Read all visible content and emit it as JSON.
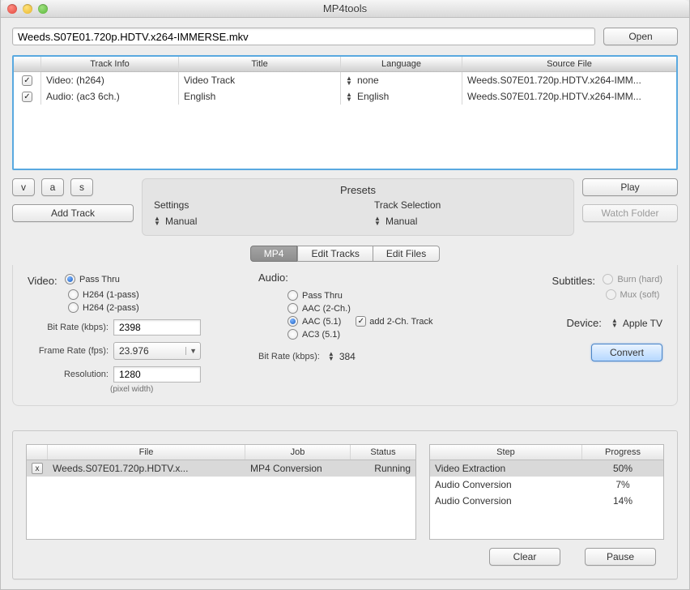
{
  "titlebar": {
    "title": "MP4tools"
  },
  "file_row": {
    "path": "Weeds.S07E01.720p.HDTV.x264-IMMERSE.mkv",
    "open": "Open"
  },
  "tracks": {
    "headers": {
      "info": "Track Info",
      "title": "Title",
      "language": "Language",
      "source": "Source File"
    },
    "rows": [
      {
        "checked": true,
        "info": "Video:  (h264)",
        "title": "Video Track",
        "language": "none",
        "source": "Weeds.S07E01.720p.HDTV.x264-IMM..."
      },
      {
        "checked": true,
        "info": "Audio:  (ac3  6ch.)",
        "title": "English",
        "language": "English",
        "source": "Weeds.S07E01.720p.HDTV.x264-IMM..."
      }
    ]
  },
  "controls": {
    "v": "v",
    "a": "a",
    "s": "s",
    "add_track": "Add Track",
    "play": "Play",
    "watch_folder": "Watch Folder"
  },
  "presets": {
    "title": "Presets",
    "settings_label": "Settings",
    "settings_value": "Manual",
    "track_label": "Track Selection",
    "track_value": "Manual"
  },
  "tabs": {
    "mp4": "MP4",
    "edit_tracks": "Edit Tracks",
    "edit_files": "Edit Files"
  },
  "video": {
    "label": "Video:",
    "opts": {
      "pass_thru": "Pass Thru",
      "h264_1": "H264 (1-pass)",
      "h264_2": "H264 (2-pass)"
    },
    "bitrate_label": "Bit Rate (kbps):",
    "bitrate_value": "2398",
    "framerate_label": "Frame Rate (fps):",
    "framerate_value": "23.976",
    "resolution_label": "Resolution:",
    "resolution_value": "1280",
    "resolution_hint": "(pixel width)"
  },
  "audio": {
    "label": "Audio:",
    "opts": {
      "pass_thru": "Pass Thru",
      "aac2": "AAC (2-Ch.)",
      "aac51": "AAC (5.1)",
      "ac351": "AC3 (5.1)"
    },
    "add2ch": "add 2-Ch. Track",
    "bitrate_label": "Bit Rate (kbps):",
    "bitrate_value": "384"
  },
  "subtitles": {
    "label": "Subtitles:",
    "burn": "Burn (hard)",
    "mux": "Mux (soft)"
  },
  "device": {
    "label": "Device:",
    "value": "Apple TV"
  },
  "convert": "Convert",
  "jobs": {
    "headers": {
      "file": "File",
      "job": "Job",
      "status": "Status"
    },
    "rows": [
      {
        "file": "Weeds.S07E01.720p.HDTV.x...",
        "job": "MP4 Conversion",
        "status": "Running"
      }
    ]
  },
  "steps": {
    "headers": {
      "step": "Step",
      "progress": "Progress"
    },
    "rows": [
      {
        "step": "Video Extraction",
        "progress": "50%"
      },
      {
        "step": "Audio Conversion",
        "progress": "7%"
      },
      {
        "step": "Audio Conversion",
        "progress": "14%"
      }
    ]
  },
  "bottom": {
    "clear": "Clear",
    "pause": "Pause"
  }
}
